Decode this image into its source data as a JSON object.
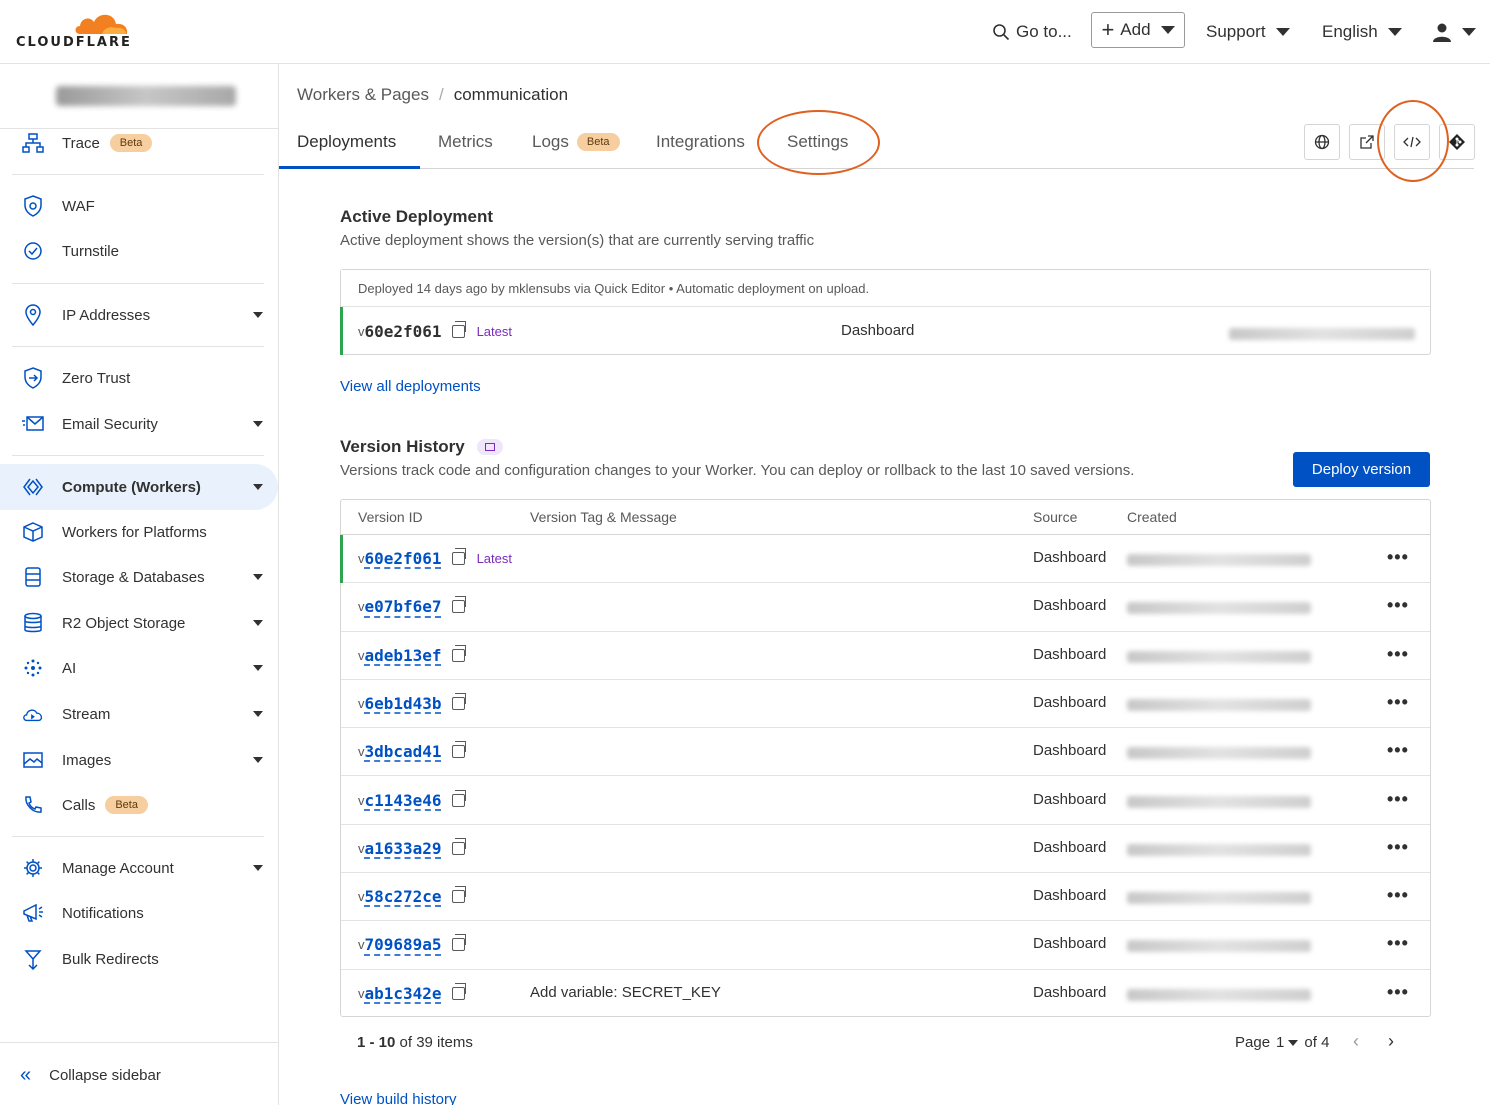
{
  "topbar": {
    "logo_text": "CLOUDFLARE",
    "goto_label": "Go to...",
    "add_label": "Add",
    "support_label": "Support",
    "language_label": "English"
  },
  "sidebar": {
    "items": [
      {
        "label": "Trace",
        "badge": "Beta",
        "icon": "trace-icon"
      },
      {
        "label": "WAF",
        "icon": "shield-icon"
      },
      {
        "label": "Turnstile",
        "icon": "turnstile-icon"
      },
      {
        "label": "IP Addresses",
        "icon": "location-pin-icon"
      },
      {
        "label": "Zero Trust",
        "icon": "zero-trust-icon"
      },
      {
        "label": "Email Security",
        "icon": "envelope-icon"
      },
      {
        "label": "Compute (Workers)",
        "icon": "workers-icon"
      },
      {
        "label": "Workers for Platforms",
        "icon": "box-icon"
      },
      {
        "label": "Storage & Databases",
        "icon": "database-icon"
      },
      {
        "label": "R2 Object Storage",
        "icon": "storage-icon"
      },
      {
        "label": "AI",
        "icon": "sparkle-icon"
      },
      {
        "label": "Stream",
        "icon": "cloud-play-icon"
      },
      {
        "label": "Images",
        "icon": "image-icon"
      },
      {
        "label": "Calls",
        "badge": "Beta",
        "icon": "phone-icon"
      },
      {
        "label": "Manage Account",
        "icon": "gear-icon"
      },
      {
        "label": "Notifications",
        "icon": "megaphone-icon"
      },
      {
        "label": "Bulk Redirects",
        "icon": "redirect-icon"
      }
    ],
    "collapse_label": "Collapse sidebar"
  },
  "breadcrumb": {
    "parent": "Workers & Pages",
    "sep": "/",
    "current": "communication"
  },
  "tabs": [
    {
      "label": "Deployments"
    },
    {
      "label": "Metrics"
    },
    {
      "label": "Logs",
      "badge": "Beta"
    },
    {
      "label": "Integrations"
    },
    {
      "label": "Settings"
    }
  ],
  "active_deployment": {
    "title": "Active Deployment",
    "subtitle": "Active deployment shows the version(s) that are currently serving traffic",
    "meta": "Deployed 14 days ago by mklensubs via Quick Editor • Automatic deployment on upload.",
    "version_prefix": "v",
    "version_id": "60e2f061",
    "latest": "Latest",
    "source": "Dashboard",
    "view_all": "View all deployments"
  },
  "version_history": {
    "title": "Version History",
    "subtitle": "Versions track code and configuration changes to your Worker. You can deploy or rollback to the last 10 saved versions.",
    "deploy_label": "Deploy version",
    "columns": [
      "Version ID",
      "Version Tag & Message",
      "Source",
      "Created"
    ],
    "rows": [
      {
        "id": "60e2f061",
        "latest": "Latest",
        "message": "",
        "source": "Dashboard"
      },
      {
        "id": "e07bf6e7",
        "latest": "",
        "message": "",
        "source": "Dashboard"
      },
      {
        "id": "adeb13ef",
        "latest": "",
        "message": "",
        "source": "Dashboard"
      },
      {
        "id": "6eb1d43b",
        "latest": "",
        "message": "",
        "source": "Dashboard"
      },
      {
        "id": "3dbcad41",
        "latest": "",
        "message": "",
        "source": "Dashboard"
      },
      {
        "id": "c1143e46",
        "latest": "",
        "message": "",
        "source": "Dashboard"
      },
      {
        "id": "a1633a29",
        "latest": "",
        "message": "",
        "source": "Dashboard"
      },
      {
        "id": "58c272ce",
        "latest": "",
        "message": "",
        "source": "Dashboard"
      },
      {
        "id": "709689a5",
        "latest": "",
        "message": "",
        "source": "Dashboard"
      },
      {
        "id": "ab1c342e",
        "latest": "",
        "message": "Add variable: SECRET_KEY",
        "source": "Dashboard"
      }
    ],
    "range_bold": "1 - 10",
    "range_rest": "of 39 items",
    "page_label": "Page",
    "page_value": "1",
    "page_of": "of 4",
    "view_build_history": "View build history"
  },
  "colors": {
    "accent": "#0051c3",
    "highlight_circle": "#e0601f",
    "logo_orange": "#f38020",
    "latest_purple": "#7a2bc1"
  }
}
